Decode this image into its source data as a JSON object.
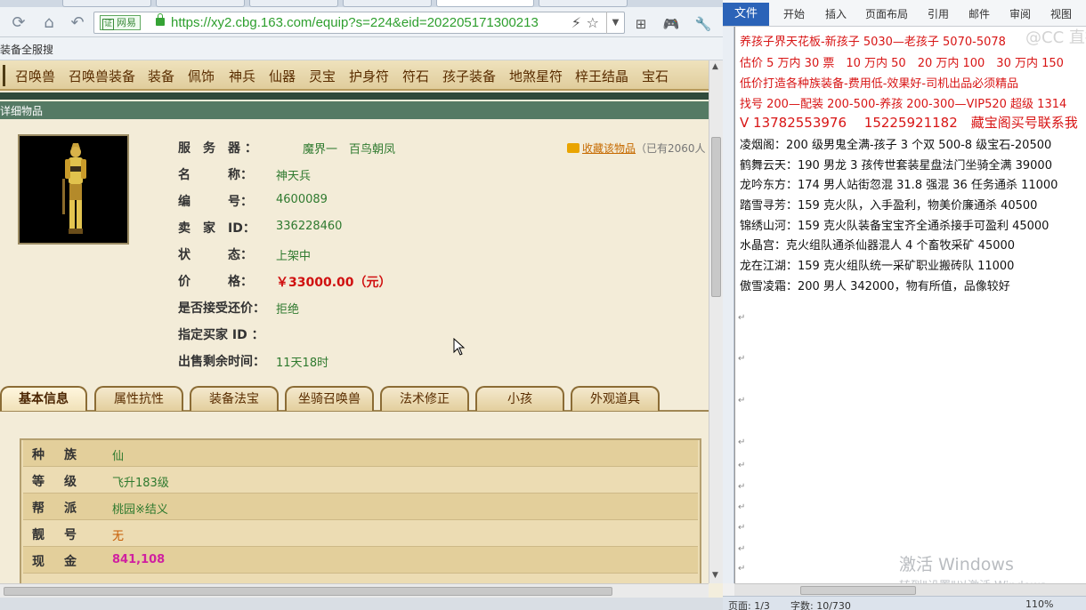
{
  "browser": {
    "url": "https://xy2.cbg.163.com/equip?s=224&eid=202205171300213",
    "site_badge": "网易",
    "cert_icon": "证",
    "bookmark": "装备全服搜",
    "nav_icons": {
      "refresh": "⟳",
      "home": "⌂",
      "back": "↶",
      "lightning": "⚡",
      "star": "☆",
      "dropdown": "▼",
      "grid": "⊞",
      "game": "🎮",
      "wrench": "🔧"
    },
    "categories": [
      "召唤兽",
      "召唤兽装备",
      "装备",
      "佩饰",
      "神兵",
      "仙器",
      "灵宝",
      "护身符",
      "符石",
      "孩子装备",
      "地煞星符",
      "梓王结晶",
      "宝石"
    ],
    "section_title": "详细物品",
    "info": {
      "server_label": "服　务　器 ：",
      "server_value": "魔界一　百鸟朝凤",
      "name_label": "名　　　称：",
      "name_value": "神天兵",
      "id_label": "编　　　号：",
      "id_value": "4600089",
      "seller_label": "卖　家　ID：",
      "seller_value": "336228460",
      "status_label": "状　　　态：",
      "status_value": "上架中",
      "price_label": "价　　　格：",
      "price_value": "￥33000.00（元）",
      "bargain_label": "是否接受还价：",
      "bargain_value": "拒绝",
      "buyer_label": "指定买家 ID ：",
      "buyer_value": "",
      "remaining_label": "出售剩余时间：",
      "remaining_value": "11天18时"
    },
    "favorite": {
      "link": "收藏该物品",
      "count": "（已有2060人"
    },
    "detail_tabs": [
      "基本信息",
      "属性抗性",
      "装备法宝",
      "坐骑召唤兽",
      "法术修正",
      "小孩",
      "外观道具"
    ],
    "attributes": [
      {
        "label": "种族",
        "value": "仙",
        "color": "#2f7a2f"
      },
      {
        "label": "等级",
        "value": "飞升183级",
        "color": "#2f7a2f"
      },
      {
        "label": "帮派",
        "value": "桃园※结义",
        "color": "#2f7a2f"
      },
      {
        "label": "靓号",
        "value": "无",
        "color": "#c65a00"
      },
      {
        "label": "现金",
        "value": "841,108",
        "color": "#d020a0"
      }
    ]
  },
  "word": {
    "tabs": {
      "file": "文件",
      "home": "开始",
      "insert": "插入",
      "layout": "页面布局",
      "ref": "引用",
      "mail": "邮件",
      "review": "审阅",
      "view": "视图"
    },
    "lines": [
      {
        "text": "养孩子界天花板-新孩子 5030—老孩子 5070-5078",
        "cls": "red"
      },
      {
        "text": "估价 5 万内 30 票　10 万内 50　20 万内 100　30 万内 150",
        "cls": "red"
      },
      {
        "text": "低价打造各种族装备-费用低-效果好-司机出品必须精品",
        "cls": "red"
      },
      {
        "text": "找号 200—配装 200-500-养孩 200-300—VIP520 超级 1314",
        "cls": "red"
      },
      {
        "text": "V 13782553976　 15225921182　藏宝阁买号联系我",
        "cls": "red big"
      },
      {
        "text": "凌烟阁：200 级男鬼全满-孩子 3 个双 500-8 级宝石-20500",
        "cls": "blk"
      },
      {
        "text": "鹤舞云天：190 男龙 3 孩传世套装星盘法门坐骑全满 39000",
        "cls": "blk"
      },
      {
        "text": "龙吟东方：174 男人站街忽混 31.8 强混 36 任务通杀 11000",
        "cls": "blk"
      },
      {
        "text": "踏雪寻芳：159 克火队，入手盈利，物美价廉通杀 40500",
        "cls": "blk"
      },
      {
        "text": "锦绣山河：159 克火队装备宝宝齐全通杀接手可盈利 45000",
        "cls": "blk"
      },
      {
        "text": "水晶宫：克火组队通杀仙器混人 4 个畜牧采矿 45000",
        "cls": "blk"
      },
      {
        "text": "龙在江湖：159 克火组队统一采矿职业搬砖队 11000",
        "cls": "blk"
      },
      {
        "text": "傲雪凌霜：200 男人 342000，物有所值，品像较好",
        "cls": "blk"
      }
    ],
    "para_mark": "↵",
    "watermark": "激活 Windows",
    "watermark_sub": "转到\"设置\"以激活 Windows。",
    "logo": "@CC 直播",
    "status": {
      "page": "页面: 1/3",
      "words": "字数: 10/730",
      "zoom": "110%"
    }
  }
}
